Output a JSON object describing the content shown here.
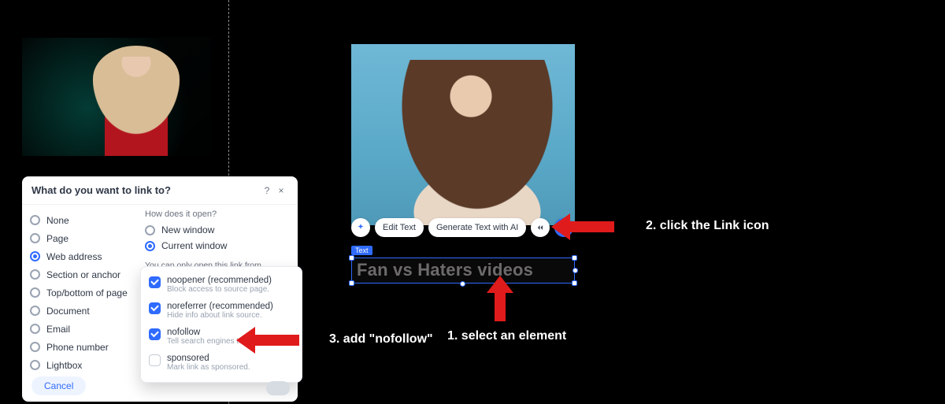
{
  "dialog": {
    "title": "What do you want to link to?",
    "help": "?",
    "close": "×",
    "link_types": [
      {
        "label": "None",
        "selected": false
      },
      {
        "label": "Page",
        "selected": false
      },
      {
        "label": "Web address",
        "selected": true
      },
      {
        "label": "Section or anchor",
        "selected": false
      },
      {
        "label": "Top/bottom of page",
        "selected": false
      },
      {
        "label": "Document",
        "selected": false
      },
      {
        "label": "Email",
        "selected": false
      },
      {
        "label": "Phone number",
        "selected": false
      },
      {
        "label": "Lightbox",
        "selected": false
      }
    ],
    "open_section_title": "How does it open?",
    "open_options": [
      {
        "label": "New window",
        "selected": false
      },
      {
        "label": "Current window",
        "selected": true
      }
    ],
    "note": "You can only open this link from your published site.",
    "attributes": [
      {
        "name": "noopener (recommended)",
        "desc": "Block access to source page.",
        "checked": true
      },
      {
        "name": "noreferrer (recommended)",
        "desc": "Hide info about link source.",
        "checked": true
      },
      {
        "name": "nofollow",
        "desc": "Tell search engines to ignore.",
        "checked": true
      },
      {
        "name": "sponsored",
        "desc": "Mark link as sponsored.",
        "checked": false
      }
    ],
    "cancel": "Cancel"
  },
  "toolbar": {
    "edit_text": "Edit Text",
    "generate_ai": "Generate Text with AI"
  },
  "selection": {
    "tag": "Text",
    "text": "Fan vs Haters videos"
  },
  "annotations": {
    "a1": "1. select an element",
    "a2": "2. click the Link icon",
    "a3": "3. add \"nofollow\""
  }
}
